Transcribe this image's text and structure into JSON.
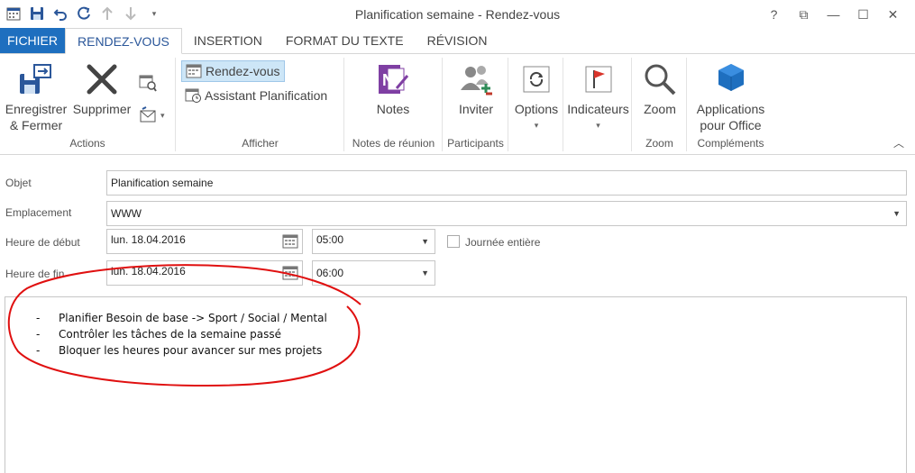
{
  "window": {
    "title": "Planification semaine  - Rendez-vous",
    "help": "?",
    "restore": "⧉",
    "minimize": "—",
    "maximize": "☐",
    "close": "✕"
  },
  "tabs": [
    {
      "label": "FICHIER"
    },
    {
      "label": "RENDEZ-VOUS"
    },
    {
      "label": "INSERTION"
    },
    {
      "label": "FORMAT DU TEXTE"
    },
    {
      "label": "RÉVISION"
    }
  ],
  "ribbon": {
    "actions": {
      "group_label": "Actions",
      "save_close_line1": "Enregistrer",
      "save_close_line2": "& Fermer",
      "delete_label": "Supprimer"
    },
    "afficher": {
      "group_label": "Afficher",
      "appointment": "Rendez-vous",
      "scheduling": "Assistant Planification"
    },
    "notes": {
      "group_label": "Notes de réunion",
      "label": "Notes"
    },
    "participants": {
      "group_label": "Participants",
      "label": "Inviter"
    },
    "options": {
      "label": "Options"
    },
    "tags": {
      "label": "Indicateurs"
    },
    "zoom": {
      "group_label": "Zoom",
      "label": "Zoom"
    },
    "addins": {
      "group_label": "Compléments",
      "line1": "Applications",
      "line2": "pour Office"
    }
  },
  "form": {
    "subject_label": "Objet",
    "subject_value": "Planification semaine",
    "location_label": "Emplacement",
    "location_value": "WWW",
    "start_label": "Heure de début",
    "start_date": "lun. 18.04.2016",
    "start_time": "05:00",
    "allday_label": "Journée entière",
    "end_label": "Heure de fin",
    "end_date": "lun. 18.04.2016",
    "end_time": "06:00"
  },
  "body": {
    "items": [
      {
        "dash": "-",
        "text": "Planifier Besoin de base -> Sport / Social / Mental"
      },
      {
        "dash": "-",
        "text": "Contrôler les tâches de la semaine passé"
      },
      {
        "dash": "-",
        "text": "Bloquer les heures pour avancer sur mes projets"
      }
    ]
  },
  "colors": {
    "file_tab": "#1e6fbf",
    "accent": "#2b579a",
    "annotation": "#e01010"
  }
}
